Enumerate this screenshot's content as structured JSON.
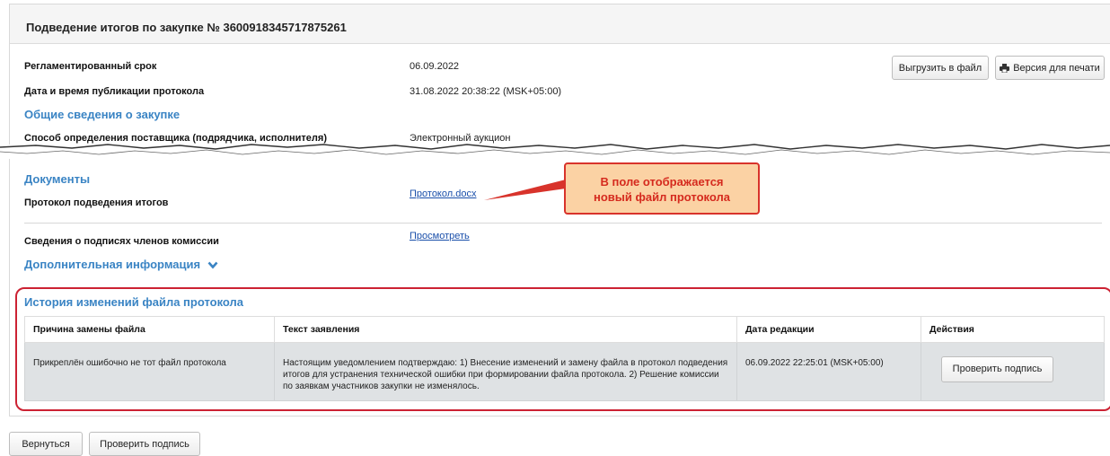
{
  "header": {
    "title": "Подведение итогов по закупке № 3600918345717875261"
  },
  "actions": {
    "export_label": "Выгрузить в файл",
    "print_label": "Версия для печати",
    "print_icon": "printer-icon"
  },
  "info": {
    "deadline_label": "Регламентированный срок",
    "deadline_value": "06.09.2022",
    "published_label": "Дата и время публикации протокола",
    "published_value": "31.08.2022 20:38:22 (MSK+05:00)",
    "general_section": "Общие сведения о закупке",
    "method_label": "Способ определения поставщика (подрядчика, исполнителя)",
    "method_value": "Электронный аукцион"
  },
  "documents": {
    "section": "Документы",
    "protocol_label": "Протокол подведения итогов",
    "protocol_link": "Протокол.docx",
    "signatures_label": "Сведения о подписях членов комиссии",
    "signatures_link": "Просмотреть",
    "additional_section": "Дополнительная информация"
  },
  "callout": {
    "line1": "В поле отображается",
    "line2": "новый файл протокола"
  },
  "history": {
    "title": "История изменений файла протокола",
    "columns": [
      "Причина замены файла",
      "Текст заявления",
      "Дата редакции",
      "Действия"
    ],
    "rows": [
      {
        "reason": "Прикреплён ошибочно не тот файл протокола",
        "text": "Настоящим уведомлением подтверждаю: 1) Внесение изменений и замену файла в протокол подведения итогов для устранения технической ошибки при формировании файла протокола. 2) Решение комиссии по заявкам участников закупки не изменялось.",
        "date": "06.09.2022 22:25:01 (MSK+05:00)",
        "action_label": "Проверить подпись"
      }
    ]
  },
  "footer": {
    "back_label": "Вернуться",
    "check_label": "Проверить подпись"
  },
  "colors": {
    "section_blue": "#3a84c4",
    "link_blue": "#1a4faa",
    "highlight_red": "#cc2233",
    "callout_bg": "#fbd2a4"
  }
}
